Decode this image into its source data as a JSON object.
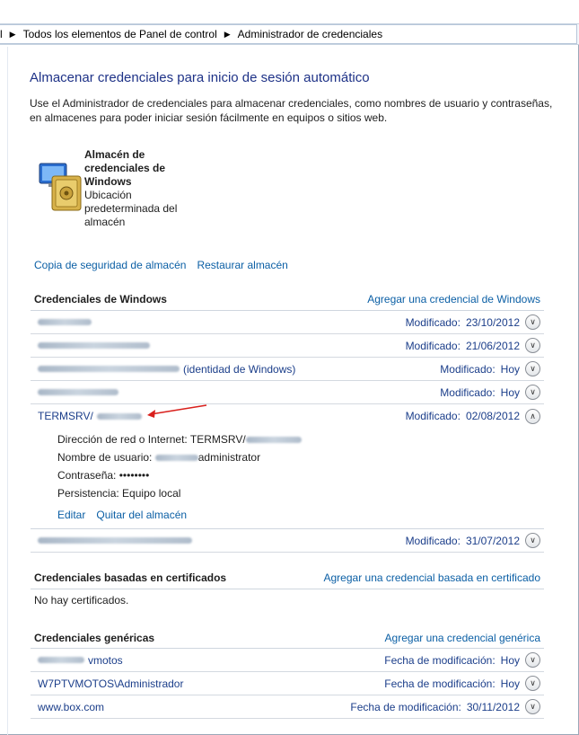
{
  "breadcrumb": {
    "items": [
      "l",
      "Todos los elementos de Panel de control",
      "Administrador de credenciales"
    ]
  },
  "page_title": "Almacenar credenciales para inicio de sesión automático",
  "intro": "Use el Administrador de credenciales para almacenar credenciales, como nombres de usuario y contraseñas, en almacenes para poder iniciar sesión fácilmente en equipos o sitios web.",
  "vault": {
    "title": "Almacén de credenciales de Windows",
    "subtitle": "Ubicación predeterminada del almacén",
    "icon": "vault-icon"
  },
  "vault_links": {
    "backup": "Copia de seguridad de almacén",
    "restore": "Restaurar almacén"
  },
  "windows_creds": {
    "title": "Credenciales de Windows",
    "add_link": "Agregar una credencial de Windows",
    "rows": [
      {
        "suffix": "",
        "modified_label": "Modificado:",
        "date": "23/10/2012",
        "expanded": false
      },
      {
        "suffix": "",
        "modified_label": "Modificado:",
        "date": "21/06/2012",
        "expanded": false
      },
      {
        "suffix": "(identidad de Windows)",
        "modified_label": "Modificado:",
        "date": "Hoy",
        "expanded": false
      },
      {
        "suffix": "",
        "modified_label": "Modificado:",
        "date": "Hoy",
        "expanded": false
      },
      {
        "prefix": "TERMSRV/",
        "modified_label": "Modificado:",
        "date": "02/08/2012",
        "expanded": true
      },
      {
        "suffix": "",
        "modified_label": "Modificado:",
        "date": "31/07/2012",
        "expanded": false
      }
    ],
    "detail": {
      "address_label": "Dirección de red o Internet:",
      "address_value": "TERMSRV/",
      "user_label": "Nombre de usuario:",
      "user_value": "administrator",
      "password_label": "Contraseña:",
      "password_value": "••••••••",
      "persistence_label": "Persistencia:",
      "persistence_value": "Equipo local",
      "edit_link": "Editar",
      "remove_link": "Quitar del almacén"
    }
  },
  "cert_creds": {
    "title": "Credenciales basadas en certificados",
    "add_link": "Agregar una credencial basada en certificado",
    "empty_text": "No hay certificados."
  },
  "generic_creds": {
    "title": "Credenciales genéricas",
    "add_link": "Agregar una credencial genérica",
    "rows": [
      {
        "name": "vmotos",
        "modified_label": "Fecha de modificación:",
        "date": "Hoy"
      },
      {
        "name": "W7PTVMOTOS\\Administrador",
        "modified_label": "Fecha de modificación:",
        "date": "Hoy"
      },
      {
        "name": "www.box.com",
        "modified_label": "Fecha de modificación:",
        "date": "30/11/2012"
      }
    ]
  },
  "colors": {
    "link": "#0b5fa5",
    "title": "#1e3287",
    "accent_arrow": "#d9201c"
  }
}
